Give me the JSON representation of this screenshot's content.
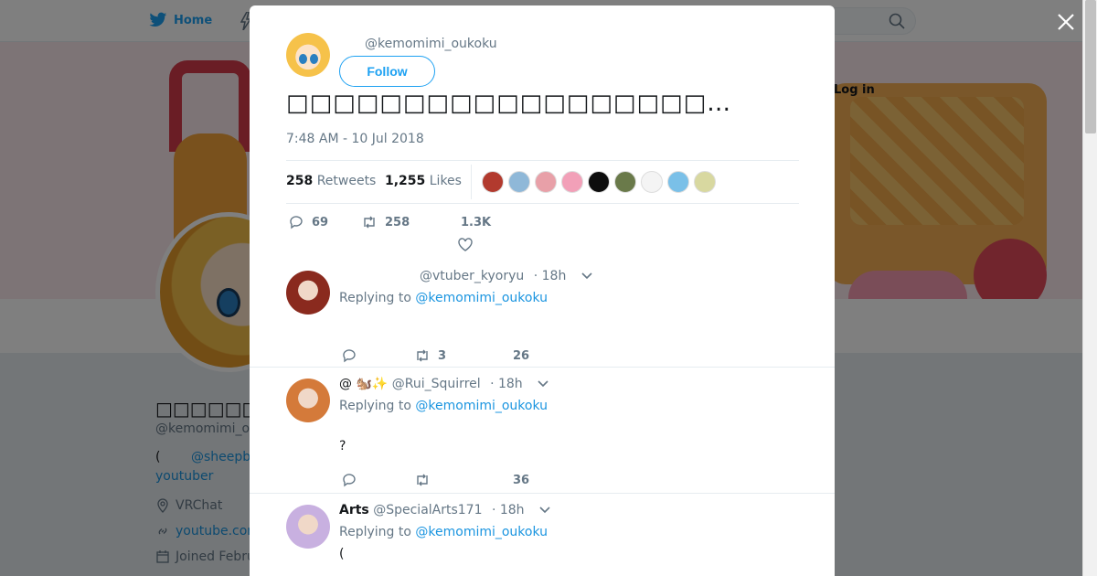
{
  "background": {
    "nav": {
      "home_label": "Home",
      "login_label": "Log in"
    },
    "profile": {
      "name": "□□□□□□□□□□",
      "handle": "@kemomimi_o",
      "bio_prefix": "(",
      "bio_link": "@sheepb",
      "bio_line2": "youtuber",
      "location": "VRChat",
      "website": "youtube.cor",
      "joined": "Joined Febru"
    }
  },
  "tweet": {
    "handle": "@kemomimi_oukoku",
    "follow_label": "Follow",
    "text": "□□□□□□□□□□□□□□□□□□…",
    "timestamp": "7:48 AM - 10 Jul 2018",
    "retweets_count": "258",
    "retweets_label": "Retweets",
    "likes_count": "1,255",
    "likes_label": "Likes",
    "actions": {
      "replies": "69",
      "retweets": "258",
      "likes": "1.3K"
    },
    "liker_colors": [
      "#b23a2e",
      "#8fb8d8",
      "#e8a0a8",
      "#f2a0b8",
      "#0d0d0d",
      "#6a7a4a",
      "#f4f4f4",
      "#7ac0e8",
      "#d8d8a0"
    ]
  },
  "replies": [
    {
      "name": "",
      "handle": "@vtuber_kyoryu",
      "time": "· 18h",
      "replying_prefix": "Replying to",
      "mention": "@kemomimi_oukoku",
      "text": "",
      "actions": {
        "replies": "",
        "retweets": "3",
        "likes": "26"
      },
      "avatar_color": "#8a2a1e"
    },
    {
      "name": "@ 🐿️✨",
      "handle": "@Rui_Squirrel",
      "time": "· 18h",
      "replying_prefix": "Replying to",
      "mention": "@kemomimi_oukoku",
      "text": "?",
      "actions": {
        "replies": "",
        "retweets": "",
        "likes": "36"
      },
      "avatar_color": "#d47a3a"
    },
    {
      "name": "Arts",
      "handle": "@SpecialArts171",
      "time": "· 18h",
      "replying_prefix": "Replying to",
      "mention": "@kemomimi_oukoku",
      "text": "(",
      "actions": {
        "replies": "",
        "retweets": "",
        "likes": ""
      },
      "avatar_color": "#c8b0e0"
    }
  ]
}
